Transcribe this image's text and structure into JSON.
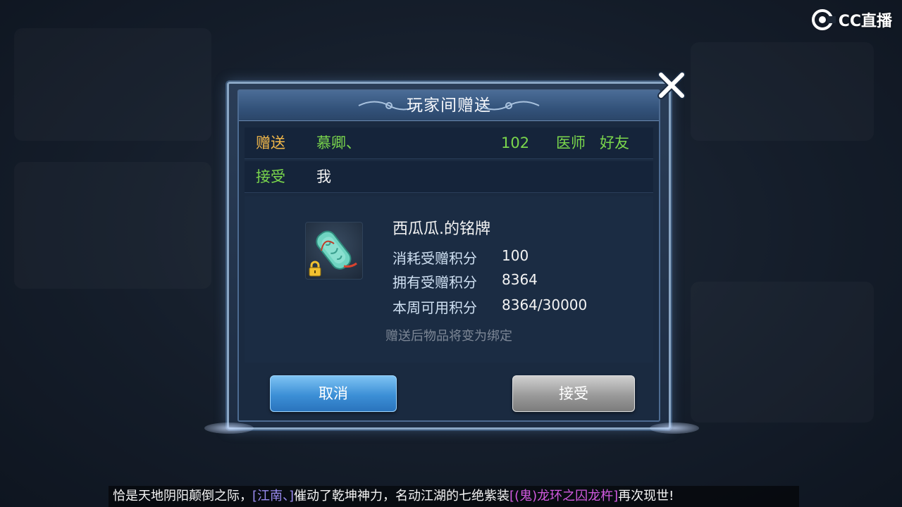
{
  "watermark": {
    "text": "CC直播"
  },
  "dialog": {
    "title": "玩家间赠送",
    "sender": {
      "label": "赠送",
      "name": "慕卿、",
      "level": "102",
      "profession": "医师",
      "relation": "好友"
    },
    "receiver": {
      "label": "接受",
      "name": "我"
    },
    "item": {
      "name": "西瓜瓜.的铭牌",
      "icon": "jade-tablet-icon",
      "locked": true,
      "stats": [
        {
          "label": "消耗受赠积分",
          "value": "100"
        },
        {
          "label": "拥有受赠积分",
          "value": "8364"
        },
        {
          "label": "本周可用积分",
          "value": "8364/30000"
        }
      ]
    },
    "note": "赠送后物品将变为绑定",
    "buttons": {
      "cancel": "取消",
      "accept": "接受"
    }
  },
  "ticker": {
    "part1": "恰是天地阴阳颠倒之际，",
    "name": "[江南、]",
    "part2": "催动了乾坤神力，名动江湖的七绝紫装",
    "item": "[(鬼)龙环之囚龙杵]",
    "part3": "再次现世!"
  },
  "colors": {
    "sender_label": "#f2b84a",
    "highlight_green": "#7ad64c",
    "cancel_button": "#3c8fd6",
    "accept_button": "#9a9a9a"
  }
}
